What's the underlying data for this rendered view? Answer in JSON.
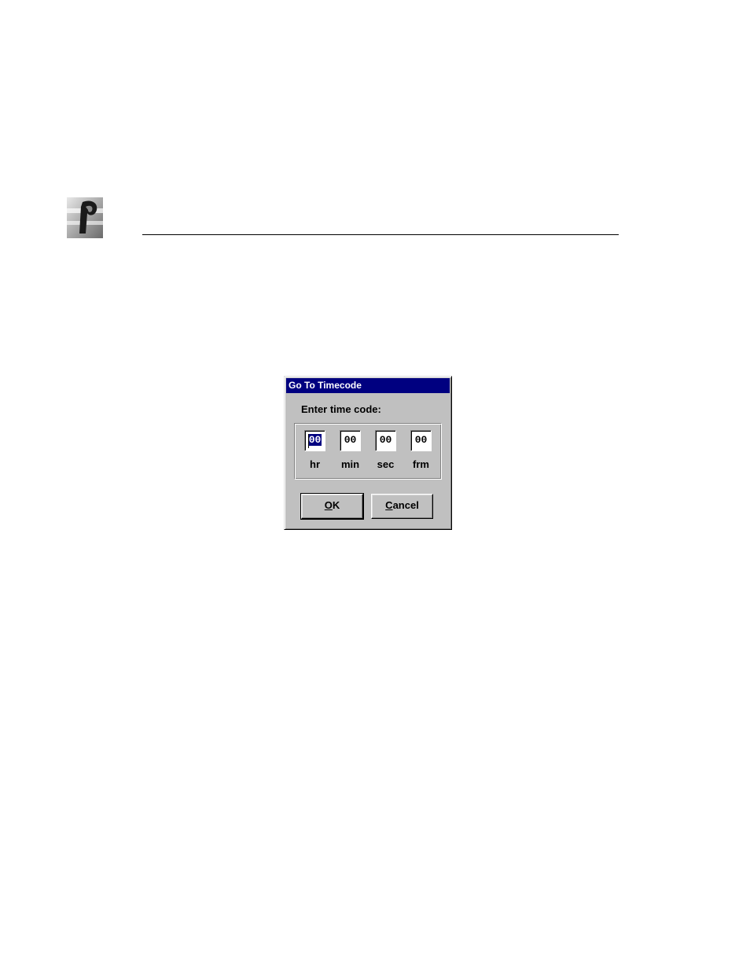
{
  "dialog": {
    "title": "Go To Timecode",
    "prompt": "Enter time code:",
    "fields": [
      {
        "value": "00",
        "label": "hr"
      },
      {
        "value": "00",
        "label": "min"
      },
      {
        "value": "00",
        "label": "sec"
      },
      {
        "value": "00",
        "label": "frm"
      }
    ],
    "ok": {
      "mnemonic": "O",
      "rest": "K"
    },
    "cancel": {
      "mnemonic": "C",
      "rest": "ancel"
    }
  },
  "colors": {
    "titlebar": "#000080",
    "face": "#c0c0c0"
  }
}
